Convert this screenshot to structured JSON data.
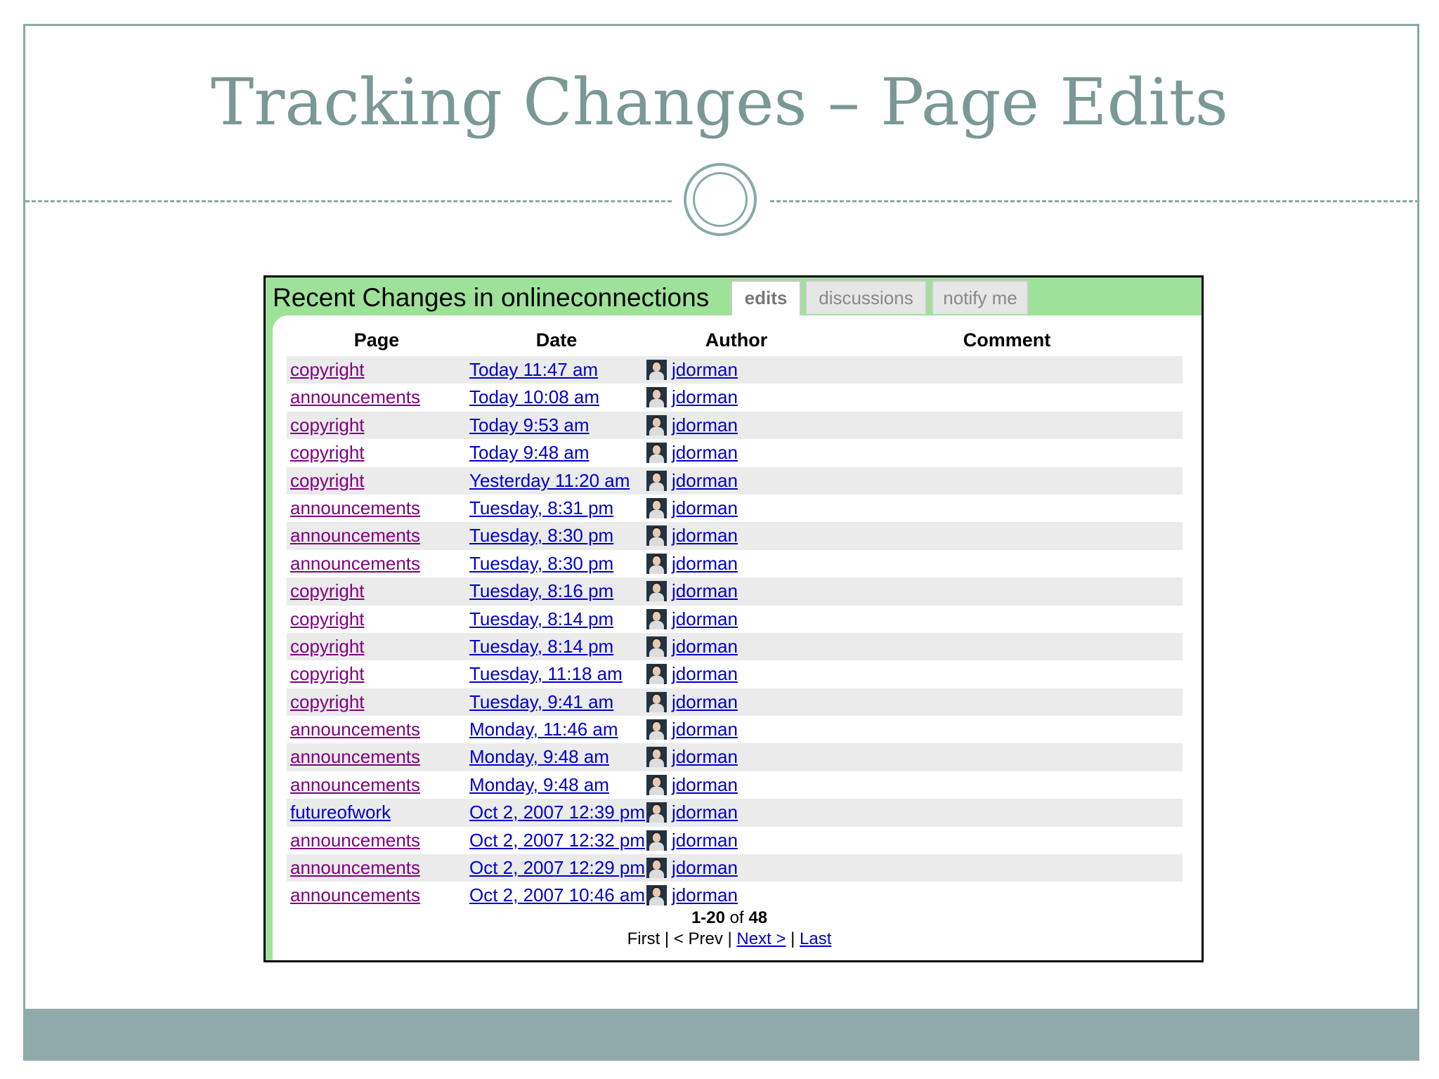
{
  "slide": {
    "title": "Tracking Changes – Page Edits"
  },
  "screenshot": {
    "title": "Recent Changes in onlineconnections",
    "tabs": [
      {
        "label": "edits",
        "active": true
      },
      {
        "label": "discussions",
        "active": false
      },
      {
        "label": "notify me",
        "active": false
      }
    ],
    "columns": [
      "Page",
      "Date",
      "Author",
      "Comment"
    ],
    "rows": [
      {
        "page": "copyright",
        "date": "Today 11:47 am",
        "author": "jdorman",
        "comment": ""
      },
      {
        "page": "announcements",
        "date": "Today 10:08 am",
        "author": "jdorman",
        "comment": ""
      },
      {
        "page": "copyright",
        "date": "Today 9:53 am",
        "author": "jdorman",
        "comment": ""
      },
      {
        "page": "copyright",
        "date": "Today 9:48 am",
        "author": "jdorman",
        "comment": ""
      },
      {
        "page": "copyright",
        "date": "Yesterday 11:20 am",
        "author": "jdorman",
        "comment": ""
      },
      {
        "page": "announcements",
        "date": "Tuesday, 8:31 pm",
        "author": "jdorman",
        "comment": ""
      },
      {
        "page": "announcements",
        "date": "Tuesday, 8:30 pm",
        "author": "jdorman",
        "comment": ""
      },
      {
        "page": "announcements",
        "date": "Tuesday, 8:30 pm",
        "author": "jdorman",
        "comment": ""
      },
      {
        "page": "copyright",
        "date": "Tuesday, 8:16 pm",
        "author": "jdorman",
        "comment": ""
      },
      {
        "page": "copyright",
        "date": "Tuesday, 8:14 pm",
        "author": "jdorman",
        "comment": ""
      },
      {
        "page": "copyright",
        "date": "Tuesday, 8:14 pm",
        "author": "jdorman",
        "comment": ""
      },
      {
        "page": "copyright",
        "date": "Tuesday, 11:18 am",
        "author": "jdorman",
        "comment": ""
      },
      {
        "page": "copyright",
        "date": "Tuesday, 9:41 am",
        "author": "jdorman",
        "comment": ""
      },
      {
        "page": "announcements",
        "date": "Monday, 11:46 am",
        "author": "jdorman",
        "comment": ""
      },
      {
        "page": "announcements",
        "date": "Monday, 9:48 am",
        "author": "jdorman",
        "comment": ""
      },
      {
        "page": "announcements",
        "date": "Monday, 9:48 am",
        "author": "jdorman",
        "comment": ""
      },
      {
        "page": "futureofwork",
        "date": "Oct 2, 2007 12:39 pm",
        "author": "jdorman",
        "comment": "",
        "unvisited": true
      },
      {
        "page": "announcements",
        "date": "Oct 2, 2007 12:32 pm",
        "author": "jdorman",
        "comment": ""
      },
      {
        "page": "announcements",
        "date": "Oct 2, 2007 12:29 pm",
        "author": "jdorman",
        "comment": ""
      },
      {
        "page": "announcements",
        "date": "Oct 2, 2007 10:46 am",
        "author": "jdorman",
        "comment": ""
      }
    ],
    "pager": {
      "range": "1-20",
      "of_label": "of",
      "total": "48",
      "first": "First",
      "prev": "< Prev",
      "next": "Next >",
      "last": "Last",
      "separator": "|"
    }
  },
  "colors": {
    "accent": "#8aa9a6",
    "footer": "#8eaba9",
    "header_green": "#9ee29a",
    "link_blue": "#0000cc",
    "visited_purple": "#800080"
  }
}
